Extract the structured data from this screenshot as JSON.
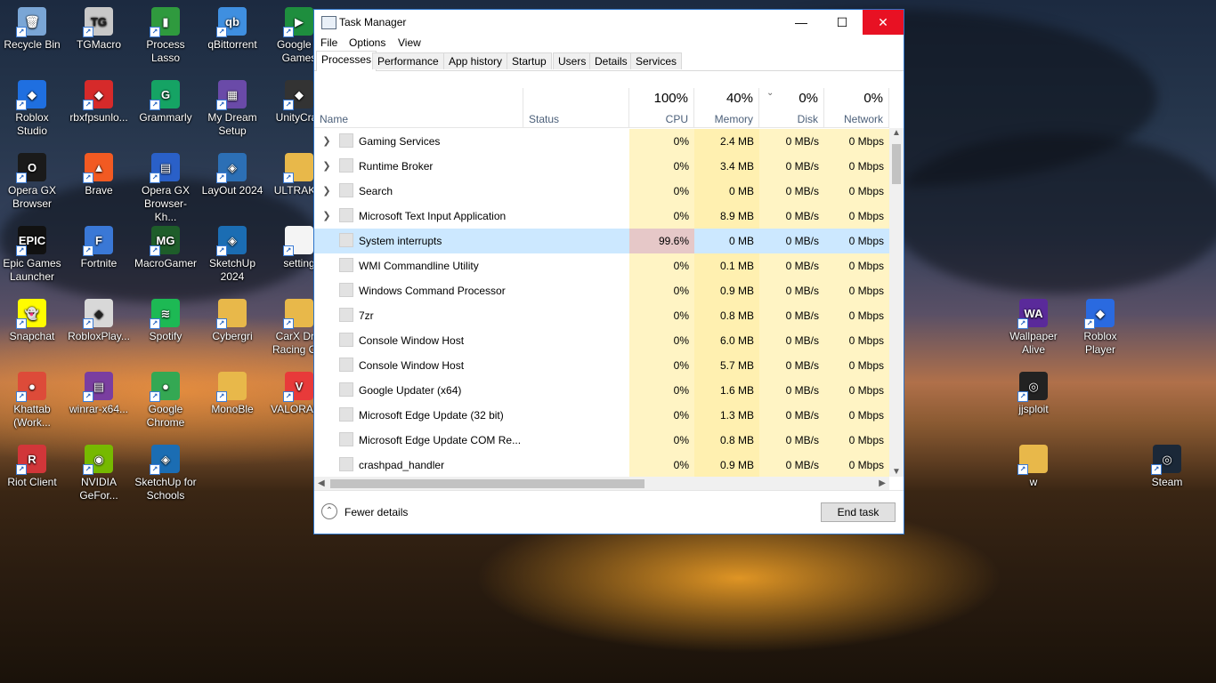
{
  "desktop": {
    "icons": [
      {
        "label": "Recycle Bin",
        "icon": "recycle-bin-icon",
        "color": "#7aa6d6",
        "glyph": "🗑"
      },
      {
        "label": "TGMacro",
        "icon": "tgmacro-icon",
        "color": "#c8c8c8",
        "glyph": "TG"
      },
      {
        "label": "Process Lasso",
        "icon": "process-lasso-icon",
        "color": "#2f9a3e",
        "glyph": "▮"
      },
      {
        "label": "qBittorrent",
        "icon": "qbittorrent-icon",
        "color": "#3f8fe0",
        "glyph": "qb"
      },
      {
        "label": "Google P Games",
        "icon": "google-play-games-icon",
        "color": "#1e8e3e",
        "glyph": "▶"
      },
      {
        "label": "Roblox Studio",
        "icon": "roblox-studio-icon",
        "color": "#1f6fe0",
        "glyph": "◆"
      },
      {
        "label": "rbxfpsunlo...",
        "icon": "rbxfpsunlocker-icon",
        "color": "#d62a2a",
        "glyph": "◆"
      },
      {
        "label": "Grammarly",
        "icon": "grammarly-icon",
        "color": "#15a364",
        "glyph": "G"
      },
      {
        "label": "My Dream Setup",
        "icon": "my-dream-setup-icon",
        "color": "#6a4aa8",
        "glyph": "▦"
      },
      {
        "label": "UnityCras",
        "icon": "unity-icon",
        "color": "#333333",
        "glyph": "◆"
      },
      {
        "label": "Opera GX Browser",
        "icon": "opera-gx-icon",
        "color": "#1a1a1a",
        "glyph": "O"
      },
      {
        "label": "Brave",
        "icon": "brave-icon",
        "color": "#f25a22",
        "glyph": "▲"
      },
      {
        "label": "Opera GX Browser-Kh...",
        "icon": "opera-gx-shortcut-icon",
        "color": "#2a60c8",
        "glyph": "▤"
      },
      {
        "label": "LayOut 2024",
        "icon": "layout-icon",
        "color": "#2c6fb5",
        "glyph": "◈"
      },
      {
        "label": "ULTRAKIL",
        "icon": "folder-icon",
        "color": "#e8b84a",
        "glyph": ""
      },
      {
        "label": "Epic Games Launcher",
        "icon": "epic-games-icon",
        "color": "#111111",
        "glyph": "EPIC"
      },
      {
        "label": "Fortnite",
        "icon": "fortnite-icon",
        "color": "#3a78d6",
        "glyph": "F"
      },
      {
        "label": "MacroGamer",
        "icon": "macrogamer-icon",
        "color": "#1e5d2a",
        "glyph": "MG"
      },
      {
        "label": "SketchUp 2024",
        "icon": "sketchup-icon",
        "color": "#1b6db3",
        "glyph": "◈"
      },
      {
        "label": "setting",
        "icon": "file-icon",
        "color": "#f4f4f4",
        "glyph": ""
      },
      {
        "label": "Snapchat",
        "icon": "snapchat-icon",
        "color": "#fffc00",
        "glyph": "👻"
      },
      {
        "label": "RobloxPlay...",
        "icon": "roblox-player-icon",
        "color": "#d8d8d8",
        "glyph": "◆"
      },
      {
        "label": "Spotify",
        "icon": "spotify-icon",
        "color": "#1db954",
        "glyph": "≋"
      },
      {
        "label": "Cybergri",
        "icon": "folder-icon",
        "color": "#e8b84a",
        "glyph": ""
      },
      {
        "label": "CarX Drift Racing O...",
        "icon": "folder-icon",
        "color": "#e8b84a",
        "glyph": ""
      },
      {
        "label": "Khattab (Work...",
        "icon": "chrome-icon",
        "color": "#dd4b39",
        "glyph": "●"
      },
      {
        "label": "winrar-x64...",
        "icon": "winrar-icon",
        "color": "#7a3ea0",
        "glyph": "▤"
      },
      {
        "label": "Google Chrome",
        "icon": "chrome-icon",
        "color": "#34a853",
        "glyph": "●"
      },
      {
        "label": "MonoBle",
        "icon": "folder-icon",
        "color": "#e8b84a",
        "glyph": ""
      },
      {
        "label": "VALORANT",
        "icon": "valorant-icon",
        "color": "#e83a3a",
        "glyph": "V"
      },
      {
        "label": "Riot Client",
        "icon": "riot-client-icon",
        "color": "#d13639",
        "glyph": "R"
      },
      {
        "label": "NVIDIA GeFor...",
        "icon": "nvidia-icon",
        "color": "#76b900",
        "glyph": "◉"
      },
      {
        "label": "SketchUp for Schools",
        "icon": "sketchup-schools-icon",
        "color": "#1b6db3",
        "glyph": "◈"
      },
      {
        "label": "Wallpaper Alive",
        "icon": "wallpaper-alive-icon",
        "color": "#5a2a9a",
        "glyph": "WA"
      },
      {
        "label": "Roblox Player",
        "icon": "roblox-player-icon",
        "color": "#2a6ae0",
        "glyph": "◆"
      },
      {
        "label": "jjsploit",
        "icon": "jjsploit-icon",
        "color": "#222222",
        "glyph": "◎"
      },
      {
        "label": "w",
        "icon": "folder-icon",
        "color": "#e8b84a",
        "glyph": ""
      },
      {
        "label": "Steam",
        "icon": "steam-icon",
        "color": "#1b2838",
        "glyph": "◎"
      }
    ]
  },
  "window": {
    "title": "Task Manager",
    "controls": {
      "minimize": "—",
      "maximize": "☐",
      "close": "✕"
    },
    "menu": [
      "File",
      "Options",
      "View"
    ],
    "tabs": [
      "Processes",
      "Performance",
      "App history",
      "Startup",
      "Users",
      "Details",
      "Services"
    ],
    "columns": {
      "name": "Name",
      "status": "Status",
      "cpu": {
        "pct": "100%",
        "label": "CPU"
      },
      "memory": {
        "pct": "40%",
        "label": "Memory"
      },
      "disk": {
        "pct": "0%",
        "label": "Disk"
      },
      "network": {
        "pct": "0%",
        "label": "Network"
      }
    },
    "processes": [
      {
        "name": "Gaming Services",
        "expandable": true,
        "cpu": "0%",
        "memory": "2.4 MB",
        "disk": "0 MB/s",
        "network": "0 Mbps",
        "selected": false
      },
      {
        "name": "Runtime Broker",
        "expandable": true,
        "cpu": "0%",
        "memory": "3.4 MB",
        "disk": "0 MB/s",
        "network": "0 Mbps",
        "selected": false
      },
      {
        "name": "Search",
        "expandable": true,
        "cpu": "0%",
        "memory": "0 MB",
        "disk": "0 MB/s",
        "network": "0 Mbps",
        "selected": false
      },
      {
        "name": "Microsoft Text Input Application",
        "expandable": true,
        "cpu": "0%",
        "memory": "8.9 MB",
        "disk": "0 MB/s",
        "network": "0 Mbps",
        "selected": false
      },
      {
        "name": "System interrupts",
        "expandable": false,
        "cpu": "99.6%",
        "memory": "0 MB",
        "disk": "0 MB/s",
        "network": "0 Mbps",
        "selected": true
      },
      {
        "name": "WMI Commandline Utility",
        "expandable": false,
        "cpu": "0%",
        "memory": "0.1 MB",
        "disk": "0 MB/s",
        "network": "0 Mbps",
        "selected": false
      },
      {
        "name": "Windows Command Processor",
        "expandable": false,
        "cpu": "0%",
        "memory": "0.9 MB",
        "disk": "0 MB/s",
        "network": "0 Mbps",
        "selected": false
      },
      {
        "name": "7zr",
        "expandable": false,
        "cpu": "0%",
        "memory": "0.8 MB",
        "disk": "0 MB/s",
        "network": "0 Mbps",
        "selected": false
      },
      {
        "name": "Console Window Host",
        "expandable": false,
        "cpu": "0%",
        "memory": "6.0 MB",
        "disk": "0 MB/s",
        "network": "0 Mbps",
        "selected": false
      },
      {
        "name": "Console Window Host",
        "expandable": false,
        "cpu": "0%",
        "memory": "5.7 MB",
        "disk": "0 MB/s",
        "network": "0 Mbps",
        "selected": false
      },
      {
        "name": "Google Updater (x64)",
        "expandable": false,
        "cpu": "0%",
        "memory": "1.6 MB",
        "disk": "0 MB/s",
        "network": "0 Mbps",
        "selected": false
      },
      {
        "name": "Microsoft Edge Update (32 bit)",
        "expandable": false,
        "cpu": "0%",
        "memory": "1.3 MB",
        "disk": "0 MB/s",
        "network": "0 Mbps",
        "selected": false
      },
      {
        "name": "Microsoft Edge Update COM Re...",
        "expandable": false,
        "cpu": "0%",
        "memory": "0.8 MB",
        "disk": "0 MB/s",
        "network": "0 Mbps",
        "selected": false
      },
      {
        "name": "crashpad_handler",
        "expandable": false,
        "cpu": "0%",
        "memory": "0.9 MB",
        "disk": "0 MB/s",
        "network": "0 Mbps",
        "selected": false
      }
    ],
    "footer": {
      "fewer_details": "Fewer details",
      "end_task": "End task"
    }
  }
}
